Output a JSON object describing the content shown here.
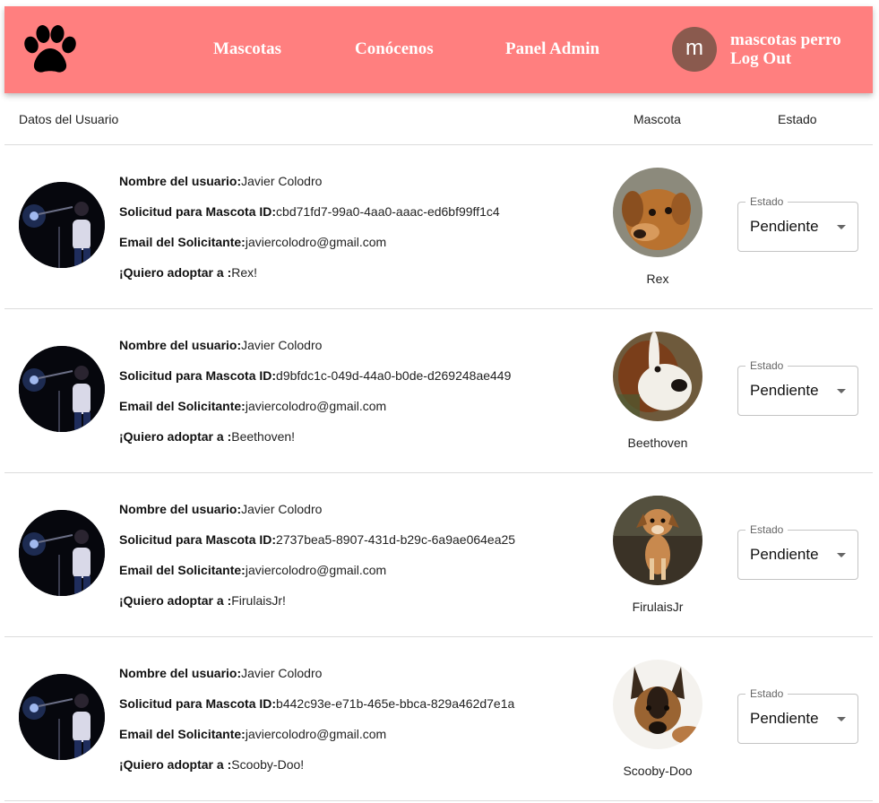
{
  "navbar": {
    "logo_icon": "paw-icon",
    "links": [
      "Mascotas",
      "Conócenos",
      "Panel Admin"
    ],
    "avatar_letter": "m",
    "user_name": "mascotas perro",
    "logout_label": "Log Out",
    "background_color": "#ff7f7f"
  },
  "table": {
    "headers": {
      "user": "Datos del Usuario",
      "pet": "Mascota",
      "status": "Estado"
    },
    "labels": {
      "name": "Nombre del usuario:",
      "request": "Solicitud para Mascota ID:",
      "email": "Email del Solicitante:",
      "adopt": "¡Quiero adoptar a :"
    },
    "rows": [
      {
        "user_name": "Javier Colodro",
        "pet_id": "cbd71fd7-99a0-4aa0-aaac-ed6bf99ff1c4",
        "email": "javiercolodro@gmail.com",
        "adopt_text": "Rex!",
        "pet_name": "Rex",
        "status_label": "Estado",
        "status_value": "Pendiente"
      },
      {
        "user_name": "Javier Colodro",
        "pet_id": "d9bfdc1c-049d-44a0-b0de-d269248ae449",
        "email": "javiercolodro@gmail.com",
        "adopt_text": "Beethoven!",
        "pet_name": "Beethoven",
        "status_label": "Estado",
        "status_value": "Pendiente"
      },
      {
        "user_name": "Javier Colodro",
        "pet_id": "2737bea5-8907-431d-b29c-6a9ae064ea25",
        "email": "javiercolodro@gmail.com",
        "adopt_text": "FirulaisJr!",
        "pet_name": "FirulaisJr",
        "status_label": "Estado",
        "status_value": "Pendiente"
      },
      {
        "user_name": "Javier Colodro",
        "pet_id": "b442c93e-e71b-465e-bbca-829a462d7e1a",
        "email": "javiercolodro@gmail.com",
        "adopt_text": "Scooby-Doo!",
        "pet_name": "Scooby-Doo",
        "status_label": "Estado",
        "status_value": "Pendiente"
      }
    ]
  }
}
